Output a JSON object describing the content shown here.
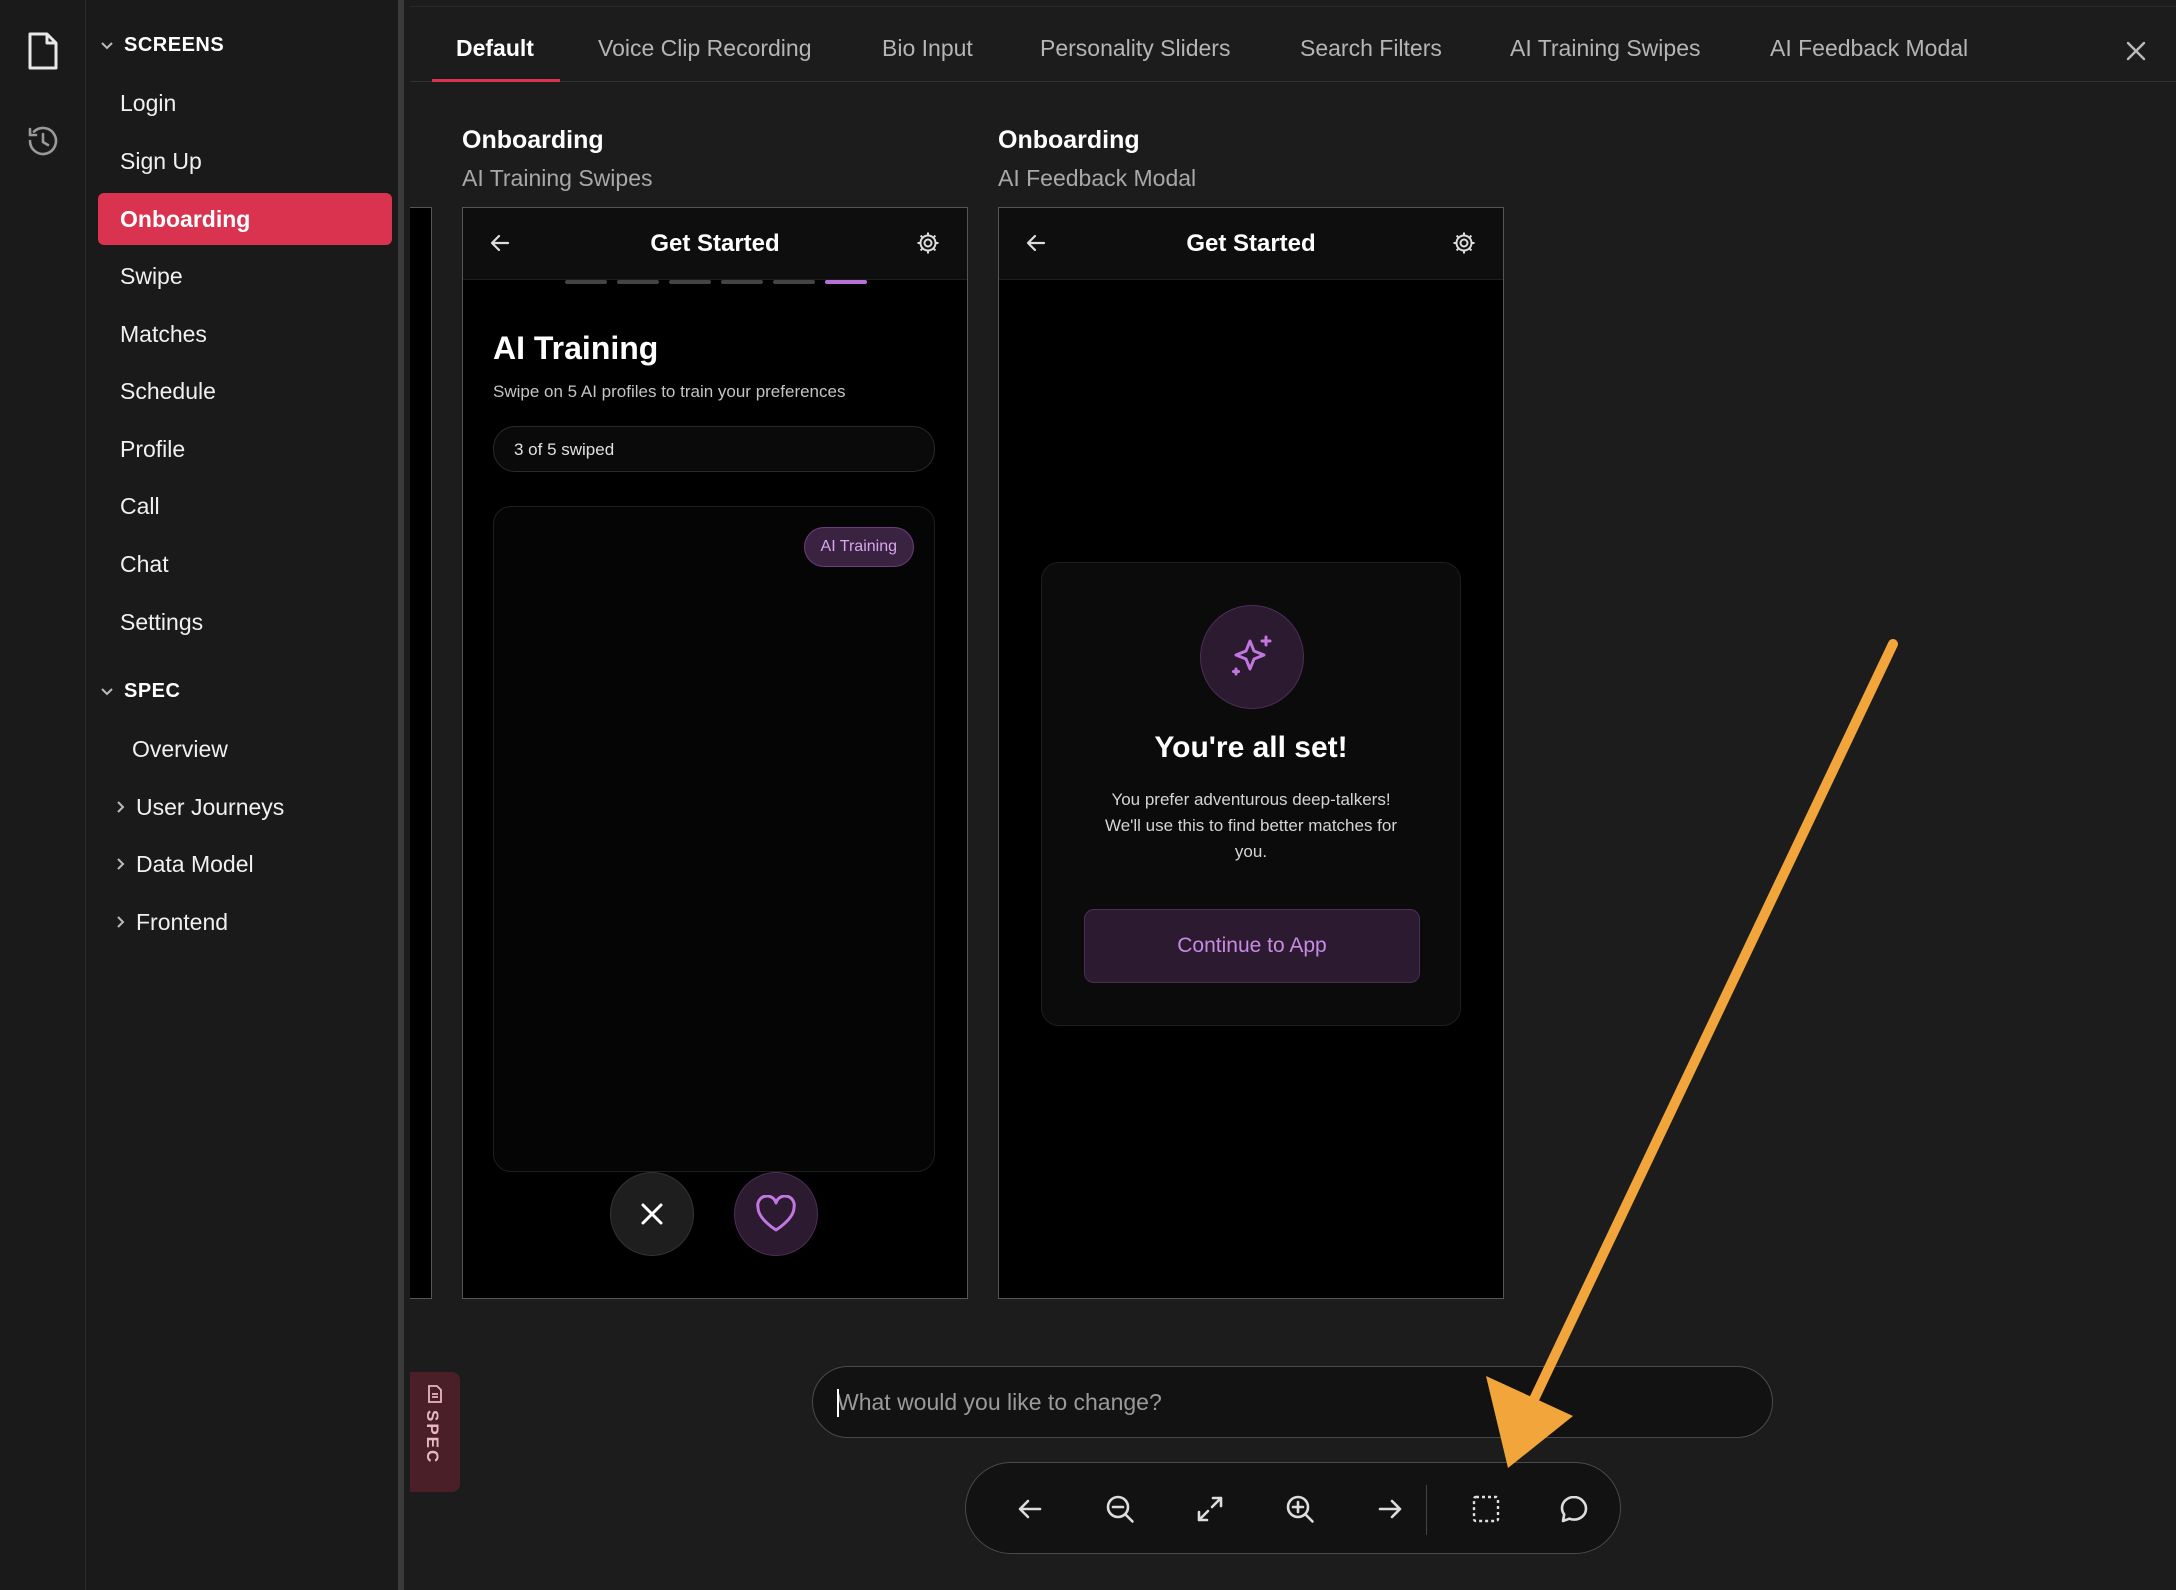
{
  "sidebar": {
    "screens_header": "SCREENS",
    "screens": [
      "Login",
      "Sign Up",
      "Onboarding",
      "Swipe",
      "Matches",
      "Schedule",
      "Profile",
      "Call",
      "Chat",
      "Settings"
    ],
    "active_screen": "Onboarding",
    "spec_header": "SPEC",
    "spec_items": [
      "Overview",
      "User Journeys",
      "Data Model",
      "Frontend"
    ]
  },
  "tabs": [
    "Default",
    "Voice Clip Recording",
    "Bio Input",
    "Personality Sliders",
    "Search Filters",
    "AI Training Swipes",
    "AI Feedback Modal"
  ],
  "active_tab": "Default",
  "frames": [
    {
      "title": "Onboarding",
      "subtitle": "AI Training Swipes",
      "header_title": "Get Started",
      "heading": "AI Training",
      "description": "Swipe on 5 AI profiles to train your preferences",
      "counter": "3 of 5 swiped",
      "badge": "AI Training",
      "progress_total": 6,
      "progress_current": 6
    },
    {
      "title": "Onboarding",
      "subtitle": "AI Feedback Modal",
      "header_title": "Get Started",
      "modal_title": "You're all set!",
      "modal_line1": "You prefer adventurous deep-talkers!",
      "modal_line2": "We'll use this to find better matches for",
      "modal_line3": "you.",
      "modal_button": "Continue to App"
    }
  ],
  "prompt": {
    "placeholder": "What would you like to change?"
  },
  "spec_tab_label": "SPEC",
  "colors": {
    "accent": "#d9334f",
    "purple": "#b86fd8",
    "arrow": "#f2a53a"
  }
}
